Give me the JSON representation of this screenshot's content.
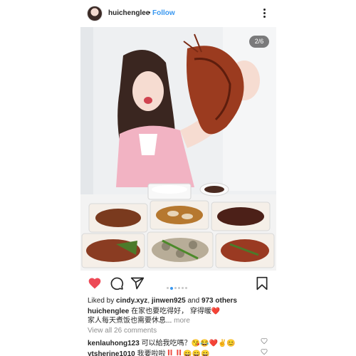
{
  "header": {
    "username": "huichenglee",
    "separator": "•",
    "follow_label": "Follow"
  },
  "photo": {
    "counter": "2/6"
  },
  "carousel": {
    "count": 6,
    "active": 2
  },
  "likes": {
    "prefix": "Liked by ",
    "user1": "cindy.xyz",
    "sep": ", ",
    "user2": "jinwen925",
    "mid": " and ",
    "others": "973 others"
  },
  "caption": {
    "username": "huichenglee",
    "line1": " 在家也要吃得好， 穿得暖❤️",
    "line2": "家人每天煮饭也需要休息",
    "ellipsis": "...",
    "more": " more"
  },
  "view_comments": "View all 26 comments",
  "comments": [
    {
      "username": "kenlauhong123",
      "text": " 可以給我吃嗎？😘😂❤️✌️😊"
    },
    {
      "username": "ytsherine1010",
      "text": " 我要啦啦‼️‼️😄😄😄"
    }
  ],
  "colors": {
    "heart": "#ed4956",
    "link": "#3897f0",
    "muted": "#8e8e8e"
  }
}
